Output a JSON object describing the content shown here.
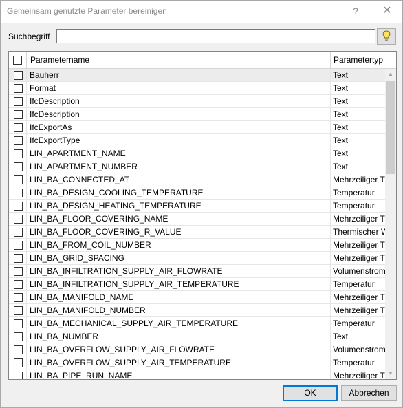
{
  "window": {
    "title": "Gemeinsam genutzte Parameter bereinigen",
    "help_label": "?",
    "close_label": "✕"
  },
  "search": {
    "label": "Suchbegriff",
    "value": "",
    "placeholder": ""
  },
  "grid": {
    "columns": {
      "name": "Parametername",
      "type": "Parametertyp"
    },
    "rows": [
      {
        "name": "Bauherr",
        "type": "Text"
      },
      {
        "name": "Format",
        "type": "Text"
      },
      {
        "name": "IfcDescription",
        "type": "Text"
      },
      {
        "name": "IfcDescription",
        "type": "Text"
      },
      {
        "name": "IfcExportAs",
        "type": "Text"
      },
      {
        "name": "IfcExportType",
        "type": "Text"
      },
      {
        "name": "LIN_APARTMENT_NAME",
        "type": "Text"
      },
      {
        "name": "LIN_APARTMENT_NUMBER",
        "type": "Text"
      },
      {
        "name": "LIN_BA_CONNECTED_AT",
        "type": "Mehrzeiliger T"
      },
      {
        "name": "LIN_BA_DESIGN_COOLING_TEMPERATURE",
        "type": "Temperatur"
      },
      {
        "name": "LIN_BA_DESIGN_HEATING_TEMPERATURE",
        "type": "Temperatur"
      },
      {
        "name": "LIN_BA_FLOOR_COVERING_NAME",
        "type": "Mehrzeiliger T"
      },
      {
        "name": "LIN_BA_FLOOR_COVERING_R_VALUE",
        "type": "Thermischer W"
      },
      {
        "name": "LIN_BA_FROM_COIL_NUMBER",
        "type": "Mehrzeiliger T"
      },
      {
        "name": "LIN_BA_GRID_SPACING",
        "type": "Mehrzeiliger T"
      },
      {
        "name": "LIN_BA_INFILTRATION_SUPPLY_AIR_FLOWRATE",
        "type": "Volumenstrom"
      },
      {
        "name": "LIN_BA_INFILTRATION_SUPPLY_AIR_TEMPERATURE",
        "type": "Temperatur"
      },
      {
        "name": "LIN_BA_MANIFOLD_NAME",
        "type": "Mehrzeiliger T"
      },
      {
        "name": "LIN_BA_MANIFOLD_NUMBER",
        "type": "Mehrzeiliger T"
      },
      {
        "name": "LIN_BA_MECHANICAL_SUPPLY_AIR_TEMPERATURE",
        "type": "Temperatur"
      },
      {
        "name": "LIN_BA_NUMBER",
        "type": "Text"
      },
      {
        "name": "LIN_BA_OVERFLOW_SUPPLY_AIR_FLOWRATE",
        "type": "Volumenstrom"
      },
      {
        "name": "LIN_BA_OVERFLOW_SUPPLY_AIR_TEMPERATURE",
        "type": "Temperatur"
      },
      {
        "name": "LIN_BA_PIPE_RUN_NAME",
        "type": "Mehrzeiliger T"
      }
    ]
  },
  "buttons": {
    "ok": "OK",
    "cancel": "Abbrechen"
  },
  "colors": {
    "selection": "#ececec",
    "ok_border": "#0078d7",
    "bulb": "#f5c400"
  },
  "icons": {
    "search_hint": "lightbulb-icon",
    "scroll_up": "chevron-up-icon",
    "scroll_down": "chevron-down-icon"
  }
}
